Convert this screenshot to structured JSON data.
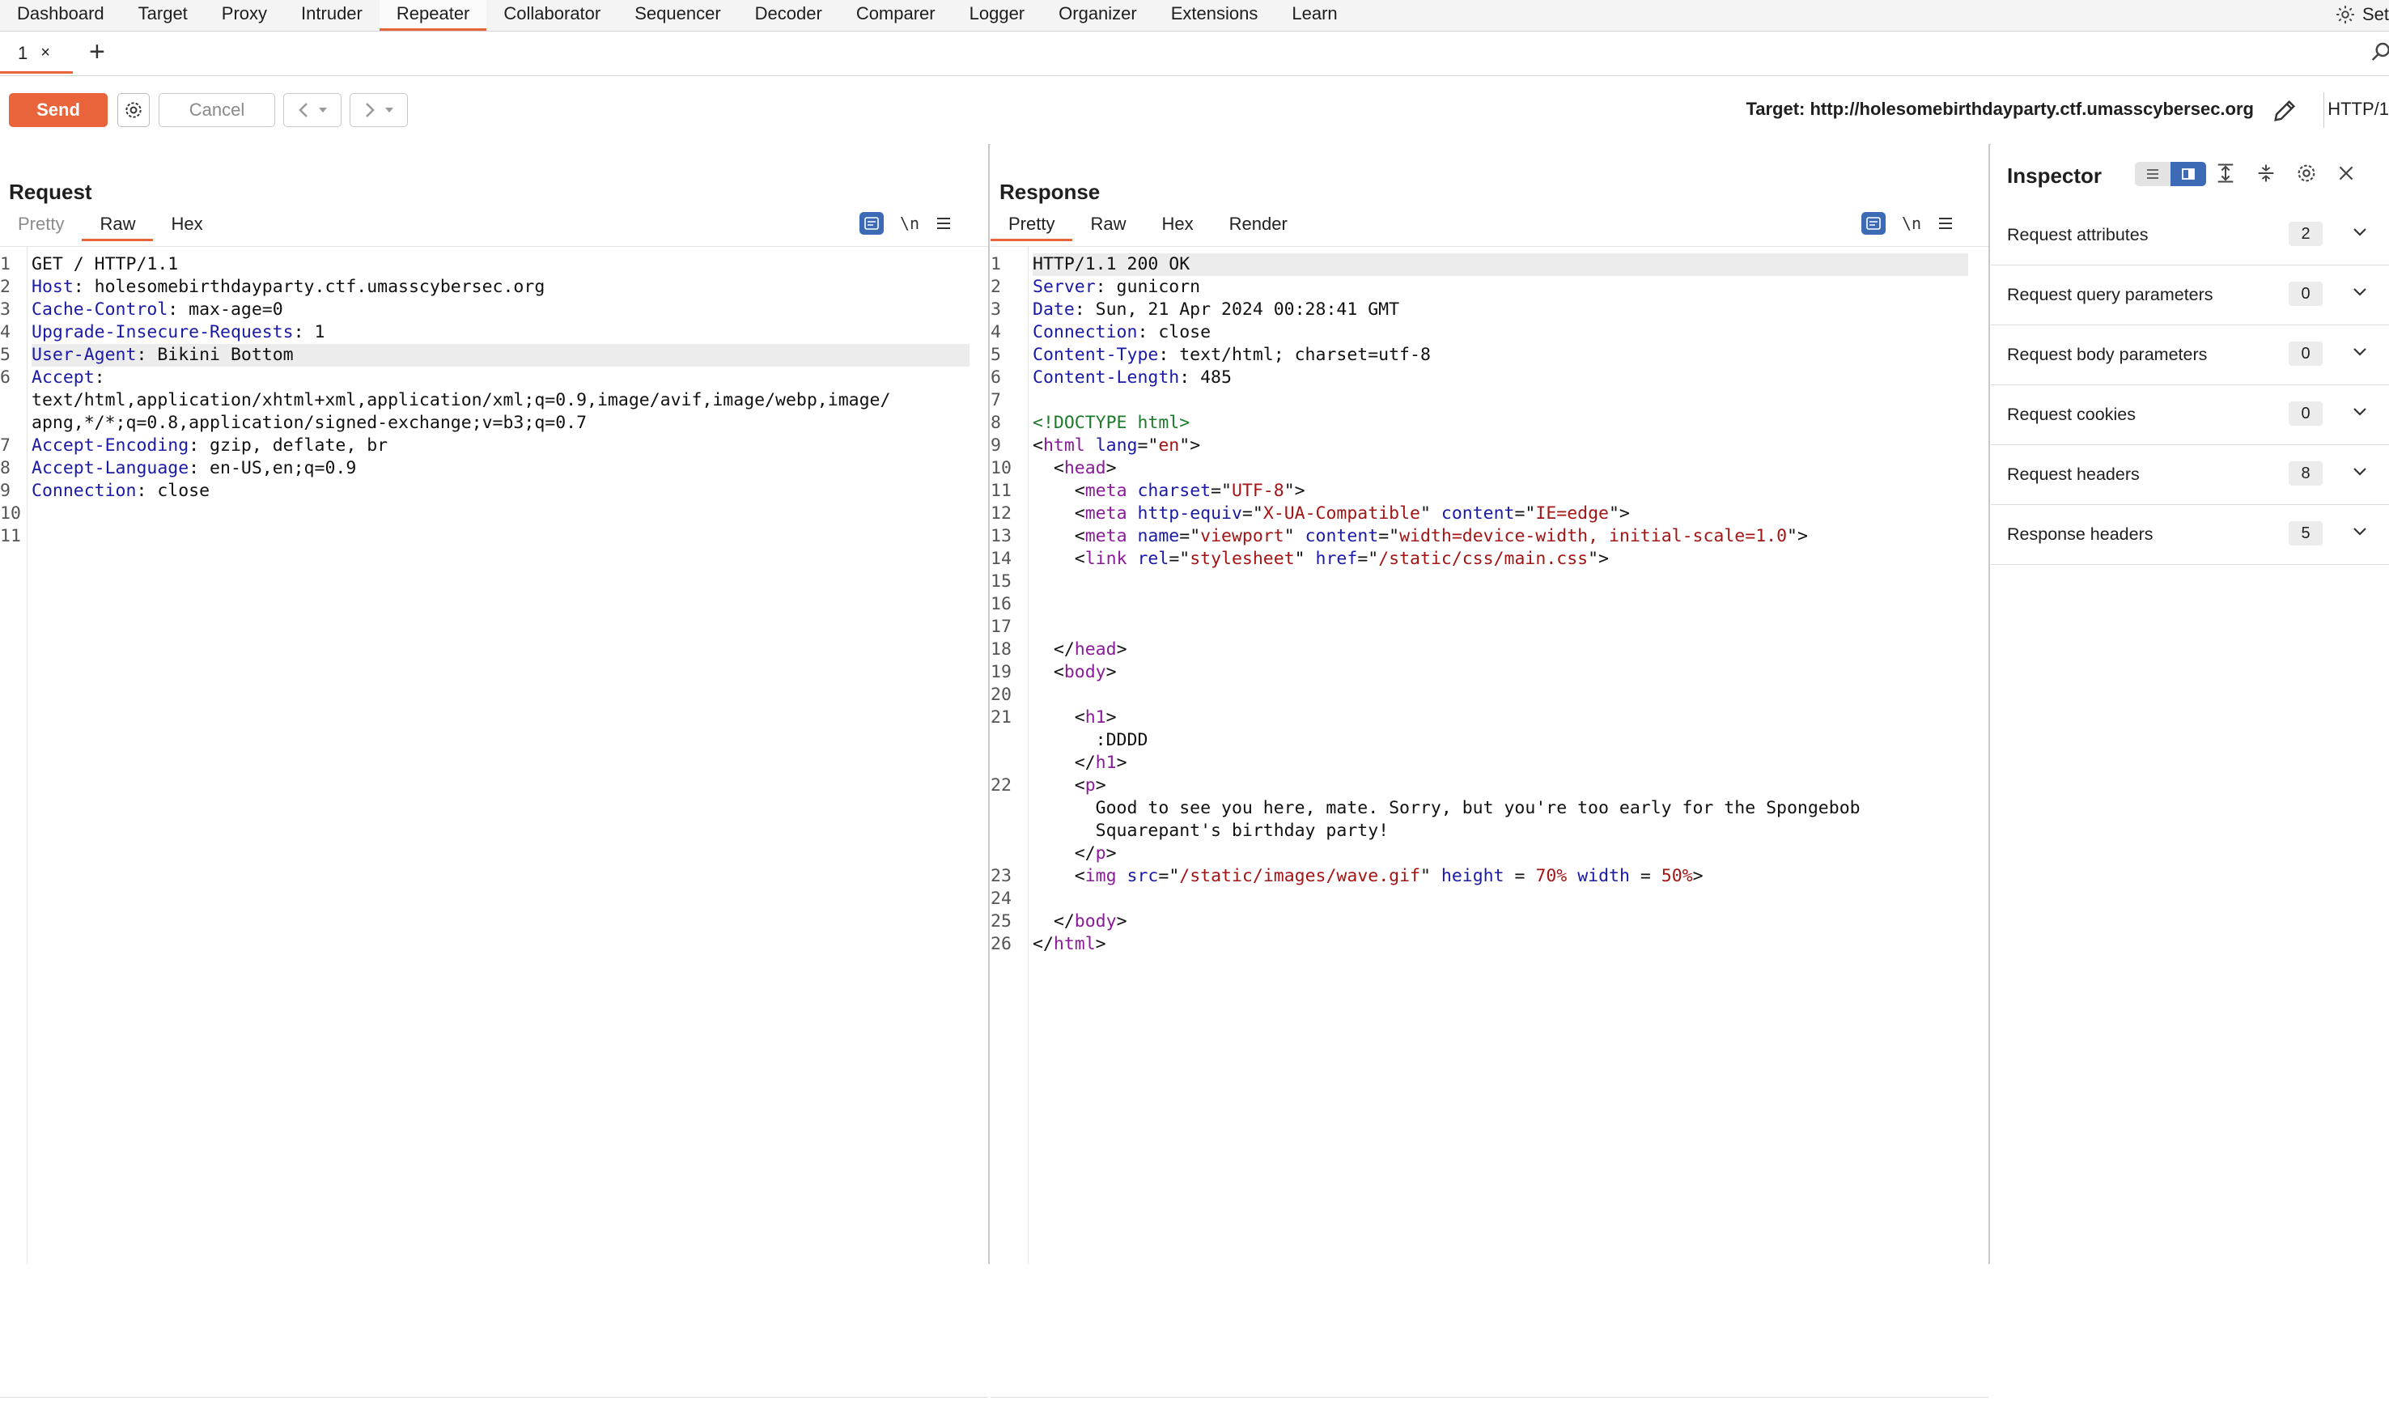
{
  "menu": {
    "tabs": [
      "Dashboard",
      "Target",
      "Proxy",
      "Intruder",
      "Repeater",
      "Collaborator",
      "Sequencer",
      "Decoder",
      "Comparer",
      "Logger",
      "Organizer",
      "Extensions",
      "Learn"
    ],
    "active": "Repeater",
    "settings_label": "Set"
  },
  "repeater_tab": {
    "label": "1",
    "close": "×",
    "add": "+"
  },
  "toolbar": {
    "send": "Send",
    "cancel": "Cancel",
    "target": "Target: http://holesomebirthdayparty.ctf.umasscybersec.org",
    "http_version": "HTTP/1"
  },
  "request": {
    "title": "Request",
    "tabs": [
      "Pretty",
      "Raw",
      "Hex"
    ],
    "active_tab": "Raw",
    "newline_toggle": "\\n",
    "lines": [
      {
        "num": "1",
        "segs": [
          {
            "t": "GET / HTTP/1.1",
            "c": ""
          }
        ]
      },
      {
        "num": "2",
        "segs": [
          {
            "t": "Host",
            "c": "kw"
          },
          {
            "t": ": holesomebirthdayparty.ctf.umasscybersec.org",
            "c": ""
          }
        ]
      },
      {
        "num": "3",
        "segs": [
          {
            "t": "Cache-Control",
            "c": "kw"
          },
          {
            "t": ": max-age=0",
            "c": ""
          }
        ]
      },
      {
        "num": "4",
        "segs": [
          {
            "t": "Upgrade-Insecure-Requests",
            "c": "kw"
          },
          {
            "t": ": 1",
            "c": ""
          }
        ]
      },
      {
        "num": "5",
        "hl": true,
        "segs": [
          {
            "t": "User-Agent",
            "c": "kw"
          },
          {
            "t": ": Bikini Bottom",
            "c": ""
          }
        ]
      },
      {
        "num": "6",
        "segs": [
          {
            "t": "Accept",
            "c": "kw"
          },
          {
            "t": ":",
            "c": ""
          }
        ]
      },
      {
        "num": "",
        "segs": [
          {
            "t": "text/html,application/xhtml+xml,application/xml;q=0.9,image/avif,image/webp,image/",
            "c": ""
          }
        ]
      },
      {
        "num": "",
        "segs": [
          {
            "t": "apng,*/*;q=0.8,application/signed-exchange;v=b3;q=0.7",
            "c": ""
          }
        ]
      },
      {
        "num": "7",
        "segs": [
          {
            "t": "Accept-Encoding",
            "c": "kw"
          },
          {
            "t": ": gzip, deflate, br",
            "c": ""
          }
        ]
      },
      {
        "num": "8",
        "segs": [
          {
            "t": "Accept-Language",
            "c": "kw"
          },
          {
            "t": ": en-US,en;q=0.9",
            "c": ""
          }
        ]
      },
      {
        "num": "9",
        "segs": [
          {
            "t": "Connection",
            "c": "kw"
          },
          {
            "t": ": close",
            "c": ""
          }
        ]
      },
      {
        "num": "10",
        "segs": []
      },
      {
        "num": "11",
        "segs": []
      }
    ]
  },
  "response": {
    "title": "Response",
    "tabs": [
      "Pretty",
      "Raw",
      "Hex",
      "Render"
    ],
    "active_tab": "Pretty",
    "newline_toggle": "\\n",
    "lines": [
      {
        "num": "1",
        "hl": true,
        "segs": [
          {
            "t": "HTTP/1.1 200 OK",
            "c": ""
          }
        ]
      },
      {
        "num": "2",
        "segs": [
          {
            "t": "Server",
            "c": "kw"
          },
          {
            "t": ": gunicorn",
            "c": ""
          }
        ]
      },
      {
        "num": "3",
        "segs": [
          {
            "t": "Date",
            "c": "kw"
          },
          {
            "t": ": Sun, 21 Apr 2024 00:28:41 GMT",
            "c": ""
          }
        ]
      },
      {
        "num": "4",
        "segs": [
          {
            "t": "Connection",
            "c": "kw"
          },
          {
            "t": ": close",
            "c": ""
          }
        ]
      },
      {
        "num": "5",
        "segs": [
          {
            "t": "Content-Type",
            "c": "kw"
          },
          {
            "t": ": text/html; charset=utf-8",
            "c": ""
          }
        ]
      },
      {
        "num": "6",
        "segs": [
          {
            "t": "Content-Length",
            "c": "kw"
          },
          {
            "t": ": 485",
            "c": ""
          }
        ]
      },
      {
        "num": "7",
        "segs": []
      },
      {
        "num": "8",
        "segs": [
          {
            "t": "<!DOCTYPE html>",
            "c": "doc"
          }
        ]
      },
      {
        "num": "9",
        "segs": [
          {
            "t": "<",
            "c": ""
          },
          {
            "t": "html",
            "c": "tag"
          },
          {
            "t": " ",
            "c": ""
          },
          {
            "t": "lang",
            "c": "attr"
          },
          {
            "t": "=\"",
            "c": ""
          },
          {
            "t": "en",
            "c": "str"
          },
          {
            "t": "\">",
            "c": ""
          }
        ]
      },
      {
        "num": "10",
        "segs": [
          {
            "t": "  <",
            "c": ""
          },
          {
            "t": "head",
            "c": "tag"
          },
          {
            "t": ">",
            "c": ""
          }
        ]
      },
      {
        "num": "11",
        "segs": [
          {
            "t": "    <",
            "c": ""
          },
          {
            "t": "meta",
            "c": "tag"
          },
          {
            "t": " ",
            "c": ""
          },
          {
            "t": "charset",
            "c": "attr"
          },
          {
            "t": "=\"",
            "c": ""
          },
          {
            "t": "UTF-8",
            "c": "str"
          },
          {
            "t": "\">",
            "c": ""
          }
        ]
      },
      {
        "num": "12",
        "segs": [
          {
            "t": "    <",
            "c": ""
          },
          {
            "t": "meta",
            "c": "tag"
          },
          {
            "t": " ",
            "c": ""
          },
          {
            "t": "http-equiv",
            "c": "attr"
          },
          {
            "t": "=\"",
            "c": ""
          },
          {
            "t": "X-UA-Compatible",
            "c": "str"
          },
          {
            "t": "\" ",
            "c": ""
          },
          {
            "t": "content",
            "c": "attr"
          },
          {
            "t": "=\"",
            "c": ""
          },
          {
            "t": "IE=edge",
            "c": "str"
          },
          {
            "t": "\">",
            "c": ""
          }
        ]
      },
      {
        "num": "13",
        "segs": [
          {
            "t": "    <",
            "c": ""
          },
          {
            "t": "meta",
            "c": "tag"
          },
          {
            "t": " ",
            "c": ""
          },
          {
            "t": "name",
            "c": "attr"
          },
          {
            "t": "=\"",
            "c": ""
          },
          {
            "t": "viewport",
            "c": "str"
          },
          {
            "t": "\" ",
            "c": ""
          },
          {
            "t": "content",
            "c": "attr"
          },
          {
            "t": "=\"",
            "c": ""
          },
          {
            "t": "width=device-width, initial-scale=1.0",
            "c": "str"
          },
          {
            "t": "\">",
            "c": ""
          }
        ]
      },
      {
        "num": "14",
        "segs": [
          {
            "t": "    <",
            "c": ""
          },
          {
            "t": "link",
            "c": "tag"
          },
          {
            "t": " ",
            "c": ""
          },
          {
            "t": "rel",
            "c": "attr"
          },
          {
            "t": "=\"",
            "c": ""
          },
          {
            "t": "stylesheet",
            "c": "str"
          },
          {
            "t": "\" ",
            "c": ""
          },
          {
            "t": "href",
            "c": "attr"
          },
          {
            "t": "=\"",
            "c": ""
          },
          {
            "t": "/static/css/main.css",
            "c": "str"
          },
          {
            "t": "\">",
            "c": ""
          }
        ]
      },
      {
        "num": "15",
        "segs": []
      },
      {
        "num": "16",
        "segs": []
      },
      {
        "num": "17",
        "segs": []
      },
      {
        "num": "18",
        "segs": [
          {
            "t": "  </",
            "c": ""
          },
          {
            "t": "head",
            "c": "tag"
          },
          {
            "t": ">",
            "c": ""
          }
        ]
      },
      {
        "num": "19",
        "segs": [
          {
            "t": "  <",
            "c": ""
          },
          {
            "t": "body",
            "c": "tag"
          },
          {
            "t": ">",
            "c": ""
          }
        ]
      },
      {
        "num": "20",
        "segs": []
      },
      {
        "num": "21",
        "segs": [
          {
            "t": "    <",
            "c": ""
          },
          {
            "t": "h1",
            "c": "tag"
          },
          {
            "t": ">",
            "c": ""
          }
        ]
      },
      {
        "num": "",
        "segs": [
          {
            "t": "      :DDDD",
            "c": ""
          }
        ]
      },
      {
        "num": "",
        "segs": [
          {
            "t": "    </",
            "c": ""
          },
          {
            "t": "h1",
            "c": "tag"
          },
          {
            "t": ">",
            "c": ""
          }
        ]
      },
      {
        "num": "22",
        "segs": [
          {
            "t": "    <",
            "c": ""
          },
          {
            "t": "p",
            "c": "tag"
          },
          {
            "t": ">",
            "c": ""
          }
        ]
      },
      {
        "num": "",
        "segs": [
          {
            "t": "      Good to see you here, mate. Sorry, but you're too early for the Spongebob",
            "c": ""
          }
        ]
      },
      {
        "num": "",
        "segs": [
          {
            "t": "      Squarepant's birthday party!",
            "c": ""
          }
        ]
      },
      {
        "num": "",
        "segs": [
          {
            "t": "    </",
            "c": ""
          },
          {
            "t": "p",
            "c": "tag"
          },
          {
            "t": ">",
            "c": ""
          }
        ]
      },
      {
        "num": "23",
        "segs": [
          {
            "t": "    <",
            "c": ""
          },
          {
            "t": "img",
            "c": "tag"
          },
          {
            "t": " ",
            "c": ""
          },
          {
            "t": "src",
            "c": "attr"
          },
          {
            "t": "=\"",
            "c": ""
          },
          {
            "t": "/static/images/wave.gif",
            "c": "str"
          },
          {
            "t": "\" ",
            "c": ""
          },
          {
            "t": "height",
            "c": "attr"
          },
          {
            "t": " = ",
            "c": ""
          },
          {
            "t": "70%",
            "c": "str"
          },
          {
            "t": " ",
            "c": ""
          },
          {
            "t": "width",
            "c": "attr"
          },
          {
            "t": " = ",
            "c": ""
          },
          {
            "t": "50%",
            "c": "str"
          },
          {
            "t": ">",
            "c": ""
          }
        ]
      },
      {
        "num": "24",
        "segs": []
      },
      {
        "num": "25",
        "segs": [
          {
            "t": "  </",
            "c": ""
          },
          {
            "t": "body",
            "c": "tag"
          },
          {
            "t": ">",
            "c": ""
          }
        ]
      },
      {
        "num": "26",
        "segs": [
          {
            "t": "</",
            "c": ""
          },
          {
            "t": "html",
            "c": "tag"
          },
          {
            "t": ">",
            "c": ""
          }
        ]
      }
    ]
  },
  "inspector": {
    "title": "Inspector",
    "sections": [
      {
        "label": "Request attributes",
        "count": "2"
      },
      {
        "label": "Request query parameters",
        "count": "0"
      },
      {
        "label": "Request body parameters",
        "count": "0"
      },
      {
        "label": "Request cookies",
        "count": "0"
      },
      {
        "label": "Request headers",
        "count": "8"
      },
      {
        "label": "Response headers",
        "count": "5"
      }
    ]
  },
  "colors": {
    "accent": "#e9643a",
    "blue": "#3d6ab5",
    "header_key": "#1a1aa6",
    "tag": "#8b1a9a",
    "string": "#a31515",
    "doctype": "#1c7a2a"
  }
}
